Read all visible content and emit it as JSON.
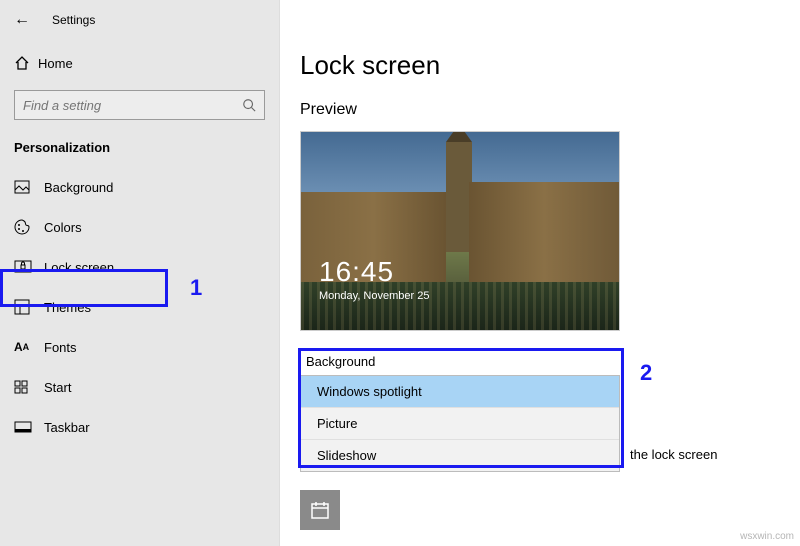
{
  "window": {
    "title": "Settings"
  },
  "sidebar": {
    "home": "Home",
    "search_placeholder": "Find a setting",
    "section": "Personalization",
    "items": [
      {
        "label": "Background"
      },
      {
        "label": "Colors"
      },
      {
        "label": "Lock screen"
      },
      {
        "label": "Themes"
      },
      {
        "label": "Fonts"
      },
      {
        "label": "Start"
      },
      {
        "label": "Taskbar"
      }
    ]
  },
  "main": {
    "title": "Lock screen",
    "preview_label": "Preview",
    "clock": {
      "time": "16:45",
      "date": "Monday, November 25"
    },
    "background_label": "Background",
    "dropdown": {
      "options": [
        "Windows spotlight",
        "Picture",
        "Slideshow"
      ],
      "selected": "Windows spotlight"
    },
    "trailing_hint": "the lock screen"
  },
  "annotations": {
    "one": "1",
    "two": "2"
  },
  "watermark": "wsxwin.com"
}
